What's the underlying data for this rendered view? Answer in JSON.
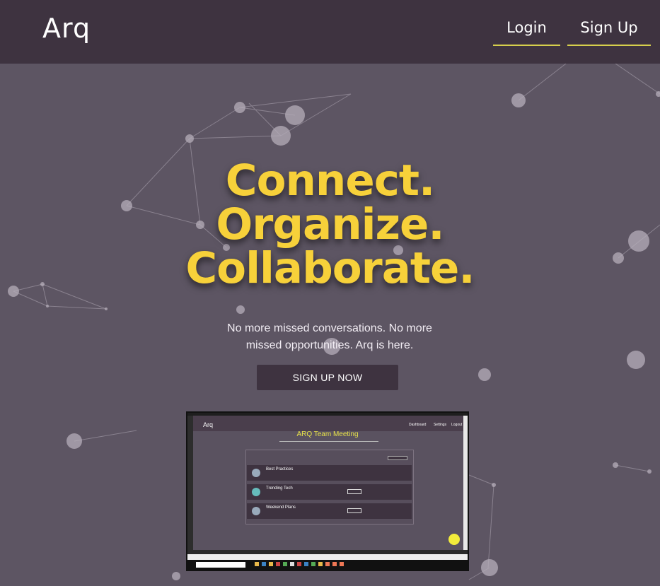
{
  "nav": {
    "logo": "Arq",
    "login_label": "Login",
    "signup_label": "Sign Up"
  },
  "hero": {
    "line1": "Connect.",
    "line2": "Organize.",
    "line3": "Collaborate.",
    "subtitle": "No more missed conversations. No more missed opportunities. Arq is here.",
    "cta_label": "SIGN UP NOW"
  },
  "preview": {
    "logo": "Arq",
    "nav_items": [
      "Dashboard",
      "Settings",
      "Logout"
    ],
    "meeting_title": "ARQ Team Meeting",
    "rows": [
      "Best Practices",
      "Trending Tech",
      "Weekend Plans"
    ]
  },
  "colors": {
    "accent": "#f7d13a",
    "nav_bg": "#3e3340",
    "page_bg": "#5d5563"
  }
}
